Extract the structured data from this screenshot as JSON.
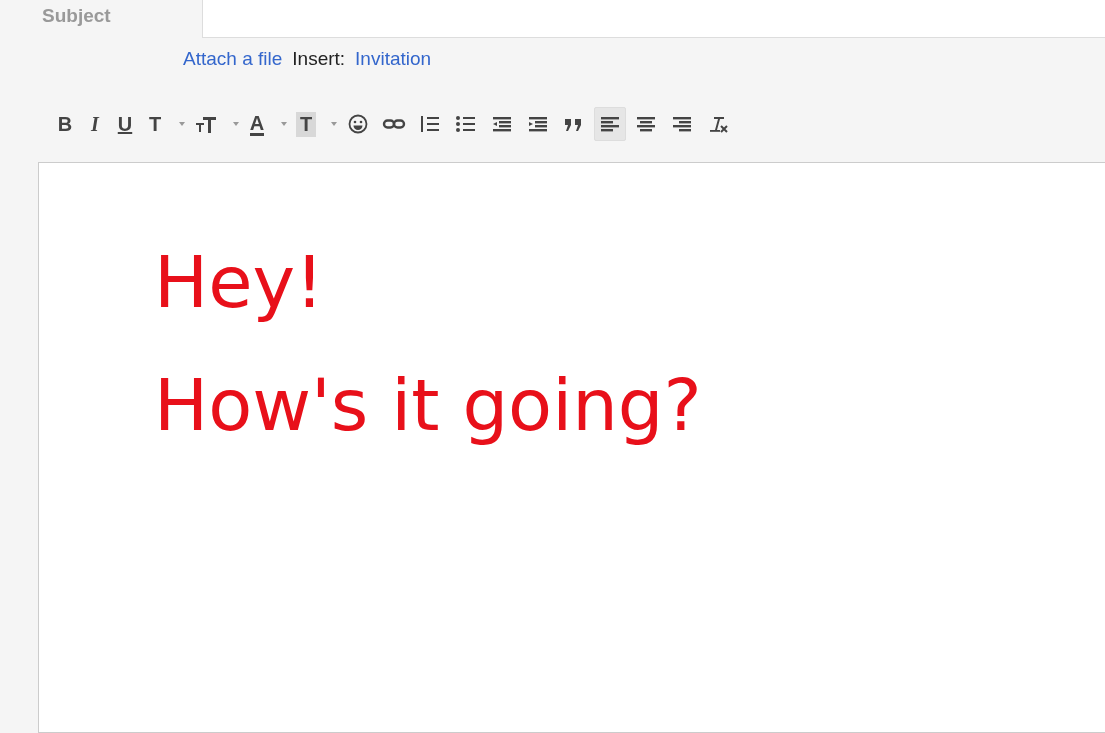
{
  "subject": {
    "label": "Subject"
  },
  "links": [
    {
      "kind": "link",
      "text": "Attach a file"
    },
    {
      "kind": "label",
      "text": "Insert:"
    },
    {
      "kind": "link",
      "text": "Invitation"
    }
  ],
  "toolbar": [
    {
      "kind": "bold",
      "label": "B",
      "selected": false,
      "dropdown": false
    },
    {
      "kind": "italic",
      "label": "I",
      "selected": false,
      "dropdown": false
    },
    {
      "kind": "underline",
      "label": "U",
      "selected": false,
      "dropdown": false
    },
    {
      "kind": "font",
      "label": "T",
      "selected": false,
      "dropdown": true
    },
    {
      "kind": "size",
      "selected": false,
      "dropdown": true
    },
    {
      "kind": "color",
      "label": "A",
      "selected": false,
      "dropdown": true
    },
    {
      "kind": "highlight",
      "label": "T",
      "selected": false,
      "dropdown": true
    },
    {
      "kind": "emoji",
      "selected": false,
      "dropdown": false
    },
    {
      "kind": "link",
      "selected": false,
      "dropdown": false
    },
    {
      "kind": "numbered",
      "selected": false,
      "dropdown": false
    },
    {
      "kind": "bulleted",
      "selected": false,
      "dropdown": false
    },
    {
      "kind": "outdent",
      "selected": false,
      "dropdown": false
    },
    {
      "kind": "indent",
      "selected": false,
      "dropdown": false
    },
    {
      "kind": "quote",
      "selected": false,
      "dropdown": false
    },
    {
      "kind": "align-left",
      "selected": true,
      "dropdown": false
    },
    {
      "kind": "align-center",
      "selected": false,
      "dropdown": false
    },
    {
      "kind": "align-right",
      "selected": false,
      "dropdown": false
    },
    {
      "kind": "clear-format",
      "selected": false,
      "dropdown": false
    }
  ],
  "body": [
    {
      "text": "Hey!"
    },
    {
      "text": "How's it going?"
    }
  ]
}
